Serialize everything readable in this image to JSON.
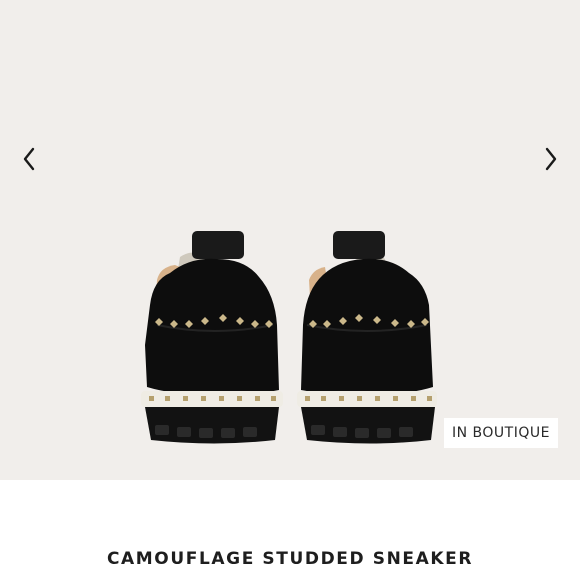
{
  "gallery": {
    "background_color": "#f1eeeb",
    "prev_icon": "chevron-left-icon",
    "next_icon": "chevron-right-icon",
    "image_alt": "Black camouflage studded sneakers, rear view",
    "badge": "IN BOUTIQUE"
  },
  "product": {
    "title": "CAMOUFLAGE STUDDED SNEAKER"
  },
  "colors": {
    "shoe": "#0d0d0d",
    "heel_tab": "#1a1a1a",
    "studs": "#cbb88a",
    "sole_band": "#efece4",
    "leather_trim": "#d8b28a"
  }
}
